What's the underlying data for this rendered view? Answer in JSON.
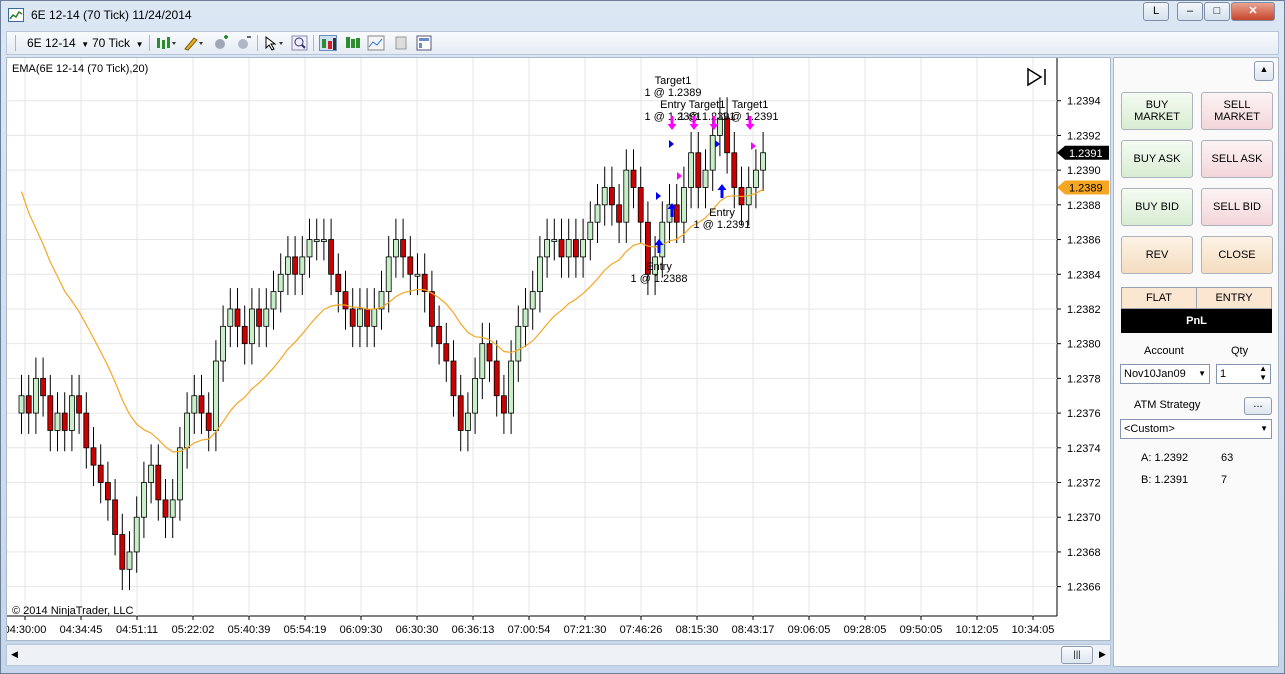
{
  "window": {
    "title": "6E 12-14 (70 Tick)  11/24/2014",
    "link_button": "L",
    "minimize": "‒",
    "maximize": "□",
    "close": "✕"
  },
  "toolbar": {
    "instrument": "6E 12-14",
    "interval": "70 Tick"
  },
  "chart": {
    "indicator_label": "EMA(6E 12-14 (70 Tick),20)",
    "copyright": "© 2014 NinjaTrader, LLC",
    "ask_price_tag": "1.2391",
    "bid_price_tag": "1.2389",
    "y_ticks": [
      "1.2394",
      "1.2392",
      "1.2390",
      "1.2388",
      "1.2386",
      "1.2384",
      "1.2382",
      "1.2380",
      "1.2378",
      "1.2376",
      "1.2374",
      "1.2372",
      "1.2370",
      "1.2368",
      "1.2366"
    ],
    "x_ticks": [
      "04:30:00",
      "04:34:45",
      "04:51:11",
      "05:22:02",
      "05:40:39",
      "05:54:19",
      "06:09:30",
      "06:30:30",
      "06:36:13",
      "07:00:54",
      "07:21:30",
      "07:46:26",
      "08:15:30",
      "08:43:17",
      "09:06:05",
      "09:28:05",
      "09:50:05",
      "10:12:05",
      "10:34:05"
    ],
    "annotations": [
      {
        "line1": "Target1",
        "line2": "1 @ 1.2389"
      },
      {
        "line1": "Entry",
        "line2": "1 @ 1.2391"
      },
      {
        "line1": "Target1",
        "line2": "1 @ 1.2391"
      },
      {
        "line1": "Target1",
        "line2": "1 @ 1.2391"
      },
      {
        "line1": "Entry",
        "line2": "1 @ 1.2391"
      },
      {
        "line1": "Entry",
        "line2": "1 @ 1.2388"
      }
    ],
    "colors": {
      "up_bar": "#c8f0c8",
      "down_bar": "#cc0000",
      "ema_line": "#f5a623",
      "buy_arrow": "#0000ff",
      "sell_arrow": "#ff00ff",
      "ask_tag": "#000000",
      "bid_tag": "#f5a623"
    }
  },
  "chart_data": {
    "type": "candlestick",
    "x_axis": "time (70 tick bars)",
    "y_axis": "price",
    "ylim": [
      1.2365,
      1.2396
    ],
    "series": [
      {
        "name": "EMA(6E 12-14 (70 Tick),20)",
        "values_description": "orange moving average line"
      }
    ],
    "closes": [
      1.2377,
      1.2376,
      1.2378,
      1.2377,
      1.2375,
      1.2376,
      1.2375,
      1.2377,
      1.2376,
      1.2374,
      1.2373,
      1.2372,
      1.2371,
      1.2369,
      1.2367,
      1.2368,
      1.237,
      1.2372,
      1.2373,
      1.2371,
      1.237,
      1.2371,
      1.2374,
      1.2376,
      1.2377,
      1.2376,
      1.2375,
      1.2379,
      1.2381,
      1.2382,
      1.2381,
      1.238,
      1.2382,
      1.2381,
      1.2382,
      1.2383,
      1.2384,
      1.2385,
      1.2384,
      1.2385,
      1.2386,
      1.2386,
      1.2386,
      1.2384,
      1.2383,
      1.2382,
      1.2381,
      1.2382,
      1.2381,
      1.2382,
      1.2383,
      1.2385,
      1.2386,
      1.2385,
      1.2384,
      1.2384,
      1.2383,
      1.2381,
      1.238,
      1.2379,
      1.2377,
      1.2375,
      1.2376,
      1.2378,
      1.238,
      1.2379,
      1.2377,
      1.2376,
      1.2379,
      1.2381,
      1.2382,
      1.2383,
      1.2385,
      1.2386,
      1.2386,
      1.2385,
      1.2386,
      1.2385,
      1.2386,
      1.2387,
      1.2388,
      1.2389,
      1.2388,
      1.2387,
      1.239,
      1.2389,
      1.2387,
      1.2384,
      1.2385,
      1.2387,
      1.2388,
      1.2387,
      1.2389,
      1.2391,
      1.2389,
      1.239,
      1.2392,
      1.2393,
      1.2391,
      1.2389,
      1.2388,
      1.2389,
      1.239,
      1.2391
    ]
  },
  "panel": {
    "buy_market": "BUY\nMARKET",
    "sell_market": "SELL\nMARKET",
    "buy_ask": "BUY ASK",
    "sell_ask": "SELL ASK",
    "buy_bid": "BUY BID",
    "sell_bid": "SELL BID",
    "rev": "REV",
    "close": "CLOSE",
    "flat": "FLAT",
    "entry": "ENTRY",
    "pnl": "PnL",
    "account_label": "Account",
    "qty_label": "Qty",
    "account_value": "Nov10Jan09",
    "qty_value": "1",
    "atm_label": "ATM Strategy",
    "atm_button": "...",
    "atm_value": "<Custom>",
    "ask_label": "A: 1.2392",
    "ask_size": "63",
    "bid_label": "B: 1.2391",
    "bid_size": "7"
  },
  "scrollbar": {
    "grip": "|||"
  }
}
